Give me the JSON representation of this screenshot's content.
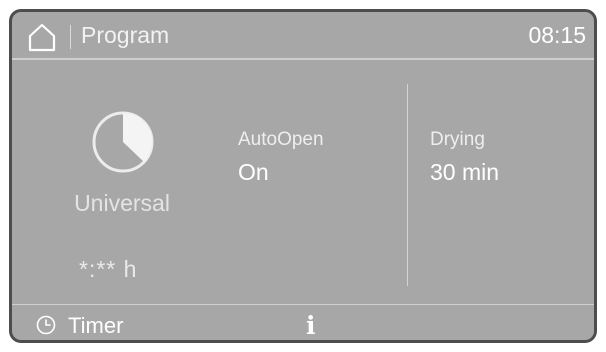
{
  "header": {
    "title": "Program",
    "clock": "08:15",
    "home_icon": "home-icon"
  },
  "program": {
    "icon": "universal-program-icon",
    "name": "Universal",
    "duration": "*:** h"
  },
  "params": {
    "autoopen": {
      "label": "AutoOpen",
      "value": "On"
    },
    "drying": {
      "label": "Drying",
      "value": "30 min"
    }
  },
  "footer": {
    "timer_label": "Timer",
    "timer_icon": "clock-icon",
    "info_label": "i",
    "info_icon": "info-icon"
  },
  "colors": {
    "screen_bg": "#a7a7a7",
    "frame": "#4d4d4d",
    "text": "#ffffff",
    "separator": "#cfcfcf"
  }
}
